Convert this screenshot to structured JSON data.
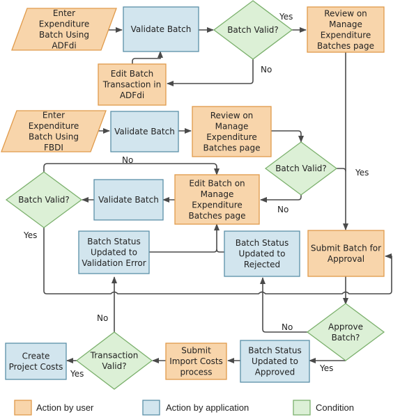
{
  "colors": {
    "user_fill": "#f8d5ab",
    "user_stroke": "#e09a4a",
    "app_fill": "#d2e5ee",
    "app_stroke": "#5a8fa8",
    "cond_fill": "#dcf0d6",
    "cond_stroke": "#7bb06c",
    "edge": "#4a4a4a"
  },
  "nodes": {
    "enter_adfdi": {
      "type": "user-input",
      "lines": [
        "Enter",
        "Expenditure",
        "Batch Using",
        "ADFdi"
      ]
    },
    "validate_1": {
      "type": "app",
      "lines": [
        "Validate Batch"
      ]
    },
    "valid_1": {
      "type": "condition",
      "lines": [
        "Batch Valid?"
      ]
    },
    "review_1": {
      "type": "user",
      "lines": [
        "Review on",
        "Manage",
        "Expenditure",
        "Batches page"
      ]
    },
    "edit_adfdi": {
      "type": "user",
      "lines": [
        "Edit Batch",
        "Transaction in",
        "ADFdi"
      ]
    },
    "enter_fbdi": {
      "type": "user-input",
      "lines": [
        "Enter",
        "Expenditure",
        "Batch Using",
        "FBDI"
      ]
    },
    "validate_2": {
      "type": "app",
      "lines": [
        "Validate Batch"
      ]
    },
    "review_2": {
      "type": "user",
      "lines": [
        "Review on",
        "Manage",
        "Expenditure",
        "Batches page"
      ]
    },
    "valid_2": {
      "type": "condition",
      "lines": [
        "Batch Valid?"
      ]
    },
    "valid_3": {
      "type": "condition",
      "lines": [
        "Batch Valid?"
      ]
    },
    "validate_3": {
      "type": "app",
      "lines": [
        "Validate Batch"
      ]
    },
    "edit_manage": {
      "type": "user",
      "lines": [
        "Edit Batch on",
        "Manage",
        "Expenditure",
        "Batches page"
      ]
    },
    "status_validation_error": {
      "type": "app",
      "lines": [
        "Batch Status",
        "Updated to",
        "Validation Error"
      ]
    },
    "status_rejected": {
      "type": "app",
      "lines": [
        "Batch Status",
        "Updated to",
        "Rejected"
      ]
    },
    "submit_approval": {
      "type": "user",
      "lines": [
        "Submit Batch for",
        "Approval"
      ]
    },
    "approve": {
      "type": "condition",
      "lines": [
        "Approve",
        "Batch?"
      ]
    },
    "status_approved": {
      "type": "app",
      "lines": [
        "Batch Status",
        "Updated to",
        "Approved"
      ]
    },
    "submit_import": {
      "type": "user",
      "lines": [
        "Submit",
        "Import Costs",
        "process"
      ]
    },
    "txn_valid": {
      "type": "condition",
      "lines": [
        "Transaction",
        "Valid?"
      ]
    },
    "create_costs": {
      "type": "app",
      "lines": [
        "Create",
        "Project Costs"
      ]
    }
  },
  "edge_labels": {
    "valid_1_yes": "Yes",
    "valid_1_no": "No",
    "valid_2_yes": "Yes",
    "valid_2_no": "No",
    "valid_3_no": "No",
    "valid_3_yes": "Yes",
    "approve_no": "No",
    "approve_yes": "Yes",
    "txn_no": "No",
    "txn_yes": "Yes"
  },
  "legend": [
    {
      "key": "user",
      "label": "Action by user"
    },
    {
      "key": "app",
      "label": "Action by application"
    },
    {
      "key": "condition",
      "label": "Condition"
    }
  ]
}
